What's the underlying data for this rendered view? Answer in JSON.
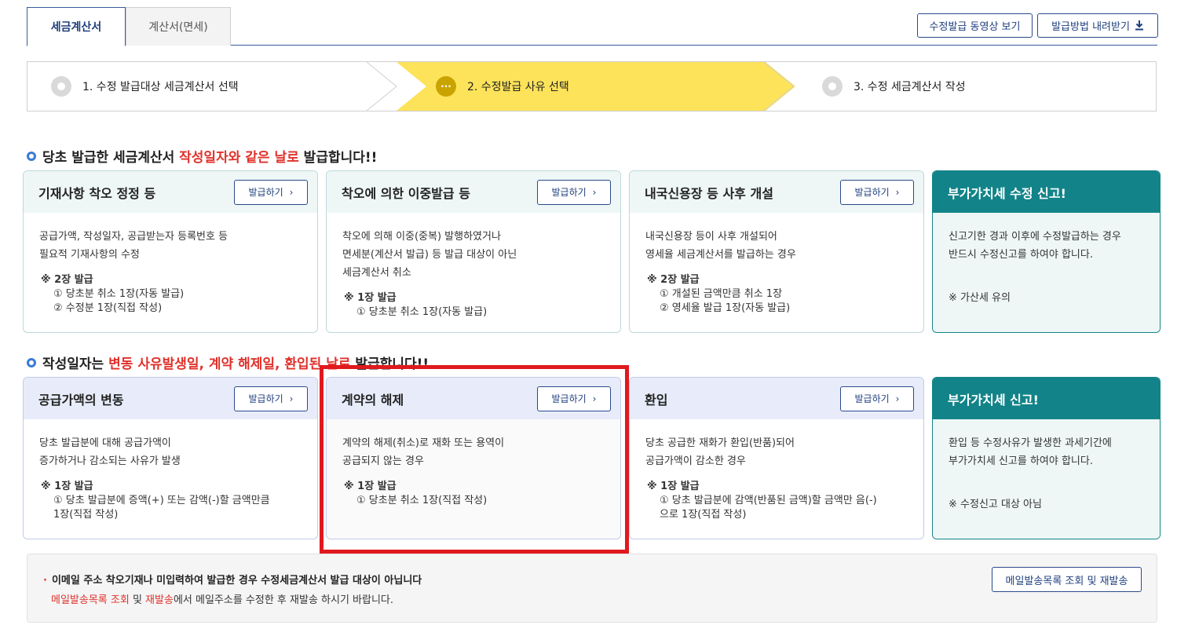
{
  "tabs": [
    {
      "label": "세금계산서",
      "active": true
    },
    {
      "label": "계산서(면세)",
      "active": false
    }
  ],
  "top_buttons": {
    "video": "수정발급 동영상 보기",
    "method": "발급방법 내려받기",
    "method_icon": "download-icon"
  },
  "steps": [
    {
      "label": "1. 수정 발급대상 세금계산서 선택",
      "active": false
    },
    {
      "label": "2. 수정발급 사유 선택",
      "active": true,
      "icon_text": "···"
    },
    {
      "label": "3. 수정 세금계산서 작성",
      "active": false
    }
  ],
  "section1": {
    "prefix": "당초 발급한 세금계산서 ",
    "highlight": "작성일자와 같은 날로",
    "suffix": " 발급합니다!!"
  },
  "section2": {
    "prefix": "작성일자는 ",
    "highlight": "변동 사유발생일, 계약 해제일, 환입된 날로",
    "suffix": " 발급합니다!!"
  },
  "issue_button_label": "발급하기",
  "cards_row1": [
    {
      "title": "기재사항 착오 정정 등",
      "desc": [
        "공급가액, 작성일자, 공급받는자 등록번호 등",
        "필요적 기재사항의 수정"
      ],
      "note_title": "※ 2장 발급",
      "note_items": [
        "① 당초분 취소 1장(자동 발급)",
        "② 수정분 1장(직접 작성)"
      ]
    },
    {
      "title": "착오에 의한 이중발급 등",
      "desc": [
        "착오에 의해 이중(중복) 발행하였거나",
        "면세분(계산서 발급) 등 발급 대상이 아닌",
        "세금계산서 취소"
      ],
      "note_title": "※ 1장 발급",
      "note_items": [
        "① 당초분 취소 1장(자동 발급)"
      ]
    },
    {
      "title": "내국신용장 등 사후 개설",
      "desc": [
        "내국신용장 등이 사후 개설되어",
        "영세율 세금계산서를 발급하는 경우"
      ],
      "note_title": "※ 2장 발급",
      "note_items": [
        "① 개설된 금액만큼 취소 1장",
        "② 영세율 발급 1장(자동 발급)"
      ]
    },
    {
      "title": "부가가치세 수정 신고!",
      "desc": [
        "신고기한 경과 이후에 수정발급하는 경우",
        "반드시 수정신고를 하여야 합니다."
      ],
      "warn": "※ 가산세 유의"
    }
  ],
  "cards_row2": [
    {
      "title": "공급가액의 변동",
      "desc": [
        "당초 발급분에 대해 공급가액이",
        "증가하거나 감소되는 사유가 발생"
      ],
      "note_title": "※ 1장 발급",
      "note_items": [
        "① 당초 발급분에 증액(+) 또는 감액(-)할 금액만큼",
        "1장(직접 작성)"
      ]
    },
    {
      "title": "계약의 해제",
      "desc": [
        "계약의 해제(취소)로 재화 또는 용역이",
        "공급되지 않는 경우"
      ],
      "note_title": "※ 1장 발급",
      "note_items": [
        "① 당초분 취소 1장(직접 작성)"
      ]
    },
    {
      "title": "환입",
      "desc": [
        "당초 공급한 재화가 환입(반품)되어",
        "공급가액이 감소한 경우"
      ],
      "note_title": "※ 1장 발급",
      "note_items": [
        "① 당초 발급분에 감액(반품된 금액)할 금액만 음(-)",
        "으로 1장(직접 작성)"
      ]
    },
    {
      "title": "부가가치세 신고!",
      "desc": [
        "환입 등 수정사유가 발생한 과세기간에",
        "부가가치세 신고를 하여야 합니다."
      ],
      "warn": "※ 수정신고 대상 아님"
    }
  ],
  "bottom": {
    "line1": "이메일 주소 착오기재나 미입력하여 발급한 경우 수정세금계산서 발급 대상이 아닙니다",
    "line2_red1": "메일발송목록 조회",
    "line2_mid": " 및 ",
    "line2_red2": "재발송",
    "line2_rest": "에서 메일주소를 수정한 후 재발송 하시기 바랍니다.",
    "button": "메일발송목록 조회 및 재발송"
  },
  "colors": {
    "accent": "#1f3e7c",
    "step_active": "#fde35a",
    "highlight_red": "#e0191e",
    "teal": "#128489"
  }
}
